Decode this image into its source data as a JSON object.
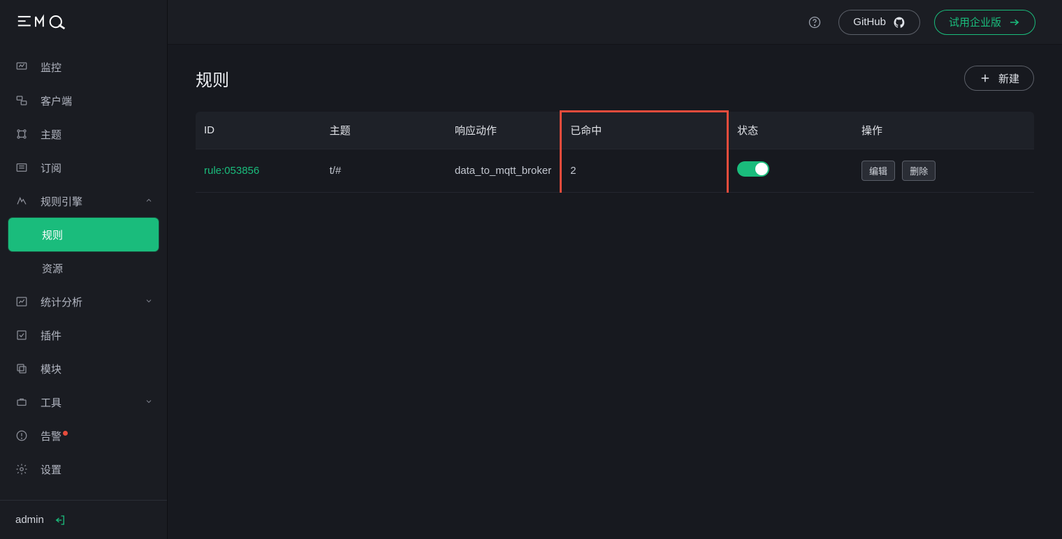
{
  "brand": "EMQ",
  "topbar": {
    "github_label": "GitHub",
    "enterprise_label": "试用企业版"
  },
  "sidebar": {
    "items": [
      {
        "label": "监控"
      },
      {
        "label": "客户端"
      },
      {
        "label": "主题"
      },
      {
        "label": "订阅"
      },
      {
        "label": "规则引擎",
        "expanded": true,
        "children": [
          {
            "label": "规则",
            "active": true
          },
          {
            "label": "资源"
          }
        ]
      },
      {
        "label": "统计分析",
        "expanded": false
      },
      {
        "label": "插件"
      },
      {
        "label": "模块"
      },
      {
        "label": "工具",
        "expanded": false
      },
      {
        "label": "告警",
        "alert": true
      },
      {
        "label": "设置"
      }
    ],
    "footer_user": "admin"
  },
  "page": {
    "title": "规则",
    "create_label": "新建"
  },
  "table": {
    "headers": {
      "id": "ID",
      "topic": "主题",
      "action": "响应动作",
      "matched": "已命中",
      "status": "状态",
      "op": "操作"
    },
    "rows": [
      {
        "id": "rule:053856",
        "topic": "t/#",
        "action": "data_to_mqtt_broker",
        "matched": "2",
        "status_on": true,
        "actions": {
          "edit": "编辑",
          "delete": "删除"
        }
      }
    ]
  },
  "highlight": {
    "column": "matched"
  }
}
